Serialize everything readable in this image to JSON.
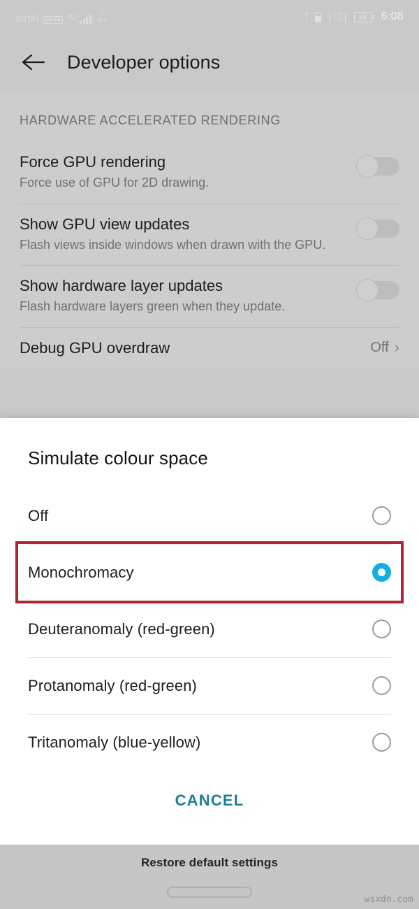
{
  "status_bar": {
    "carrier": "airtel",
    "volte_badge": "VoLTE",
    "network_type": "4G+",
    "data_rate_value": "0",
    "data_rate_unit": "K/s",
    "bluetooth_icon": "bluetooth-icon",
    "sim_icon": "sim-card-icon",
    "vibrate_icon": "vibrate-icon",
    "battery_level": "58",
    "clock": "6:08"
  },
  "app_bar": {
    "back_icon": "back-arrow-icon",
    "title": "Developer options"
  },
  "settings": {
    "section_header": "HARDWARE ACCELERATED RENDERING",
    "items": [
      {
        "label": "Force GPU rendering",
        "description": "Force use of GPU for 2D drawing.",
        "control": "switch",
        "value": "off"
      },
      {
        "label": "Show GPU view updates",
        "description": "Flash views inside windows when drawn with the GPU.",
        "control": "switch",
        "value": "off"
      },
      {
        "label": "Show hardware layer updates",
        "description": "Flash hardware layers green when they update.",
        "control": "switch",
        "value": "off"
      },
      {
        "label": "Debug GPU overdraw",
        "description": "",
        "control": "nav",
        "value": "Off",
        "chevron_icon": "chevron-right-icon"
      }
    ]
  },
  "dialog": {
    "title": "Simulate colour space",
    "options": [
      {
        "label": "Off",
        "selected": false
      },
      {
        "label": "Monochromacy",
        "selected": true
      },
      {
        "label": "Deuteranomaly (red-green)",
        "selected": false
      },
      {
        "label": "Protanomaly (red-green)",
        "selected": false
      },
      {
        "label": "Tritanomaly (blue-yellow)",
        "selected": false
      }
    ],
    "cancel_label": "CANCEL",
    "selected_value": "Monochromacy",
    "highlight_color": "#b32430",
    "accent_color": "#12aee0",
    "cancel_color": "#1a7f95"
  },
  "bottom_bar": {
    "restore_label": "Restore default settings",
    "home_indicator": "home-gesture-pill"
  },
  "watermark": "wsxdn.com"
}
